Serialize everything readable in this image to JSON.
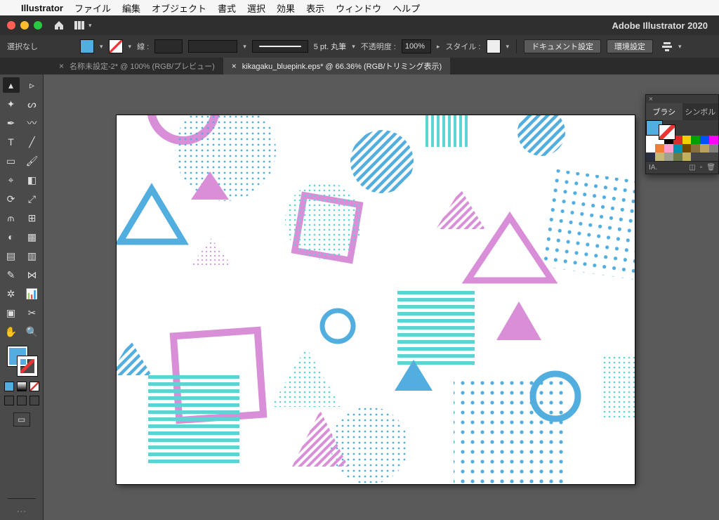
{
  "menubar": {
    "apple_icon": "",
    "app_name": "Illustrator",
    "items": [
      "ファイル",
      "編集",
      "オブジェクト",
      "書式",
      "選択",
      "効果",
      "表示",
      "ウィンドウ",
      "ヘルプ"
    ]
  },
  "titlebar": {
    "app_title": "Adobe Illustrator 2020",
    "home_icon": "home-icon",
    "doc_arrange_icon": "doc-arrange-icon"
  },
  "controlbar": {
    "selection_label": "選択なし",
    "stroke_label": "線 :",
    "stroke_weight": "",
    "brush_label": "5 pt. 丸筆",
    "opacity_label": "不透明度 :",
    "opacity_value": "100%",
    "style_label": "スタイル :",
    "doc_setup_btn": "ドキュメント設定",
    "prefs_btn": "環境設定"
  },
  "tabs": [
    {
      "label": "名称未設定-2* @ 100% (RGB/プレビュー)",
      "active": false
    },
    {
      "label": "kikagaku_bluepink.eps* @ 66.36% (RGB/トリミング表示)",
      "active": true
    }
  ],
  "panel": {
    "tabs": [
      "ブラシ",
      "シンボル"
    ],
    "active_tab": 0,
    "footer_left": "IA.",
    "swatch_colors": [
      "#ffffff",
      "#ffffff",
      "#000000",
      "#d92b2b",
      "#f0d000",
      "#00a000",
      "#0050ff",
      "#ff00ff",
      "#ffffff",
      "#f08030",
      "#ff9ecb",
      "#0090b0",
      "#704800",
      "#876f3e",
      "#bba060",
      "#808080",
      "#2a2f40",
      "#c8b878",
      "#a0a090",
      "#6a7a4a",
      "#c0b060",
      "#444444",
      "#444444",
      "#444444"
    ]
  },
  "toolbox": {
    "tools": [
      "selection-tool",
      "direct-selection-tool",
      "magic-wand-tool",
      "lasso-tool",
      "pen-tool",
      "curvature-tool",
      "type-tool",
      "line-tool",
      "rectangle-tool",
      "paintbrush-tool",
      "shaper-tool",
      "eraser-tool",
      "rotate-tool",
      "scale-tool",
      "width-tool",
      "free-transform-tool",
      "shape-builder-tool",
      "perspective-grid-tool",
      "mesh-tool",
      "gradient-tool",
      "eyedropper-tool",
      "blend-tool",
      "symbol-sprayer-tool",
      "column-graph-tool",
      "artboard-tool",
      "slice-tool",
      "hand-tool",
      "zoom-tool"
    ],
    "tool_glyphs": [
      "▴",
      "▹",
      "✦",
      "ᔕ",
      "✒",
      "〰",
      "T",
      "╱",
      "▭",
      "🖌",
      "⌖",
      "◧",
      "⟳",
      "⤢",
      "⫙",
      "⊞",
      "◐",
      "▦",
      "▤",
      "▥",
      "✎",
      "⋈",
      "✲",
      "📊",
      "▣",
      "✂",
      "✋",
      "🔍"
    ]
  },
  "colors": {
    "blue": "#53aee0",
    "pink": "#d98fd8",
    "teal": "#5ed3d3"
  }
}
